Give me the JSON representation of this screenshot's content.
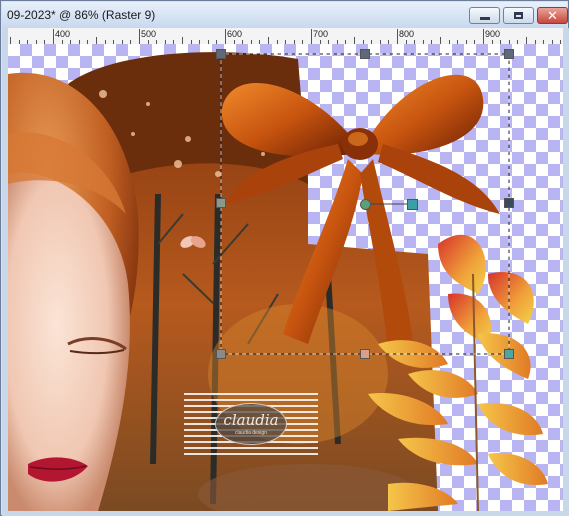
{
  "window": {
    "title": "09-2023* @  86% (Raster 9)",
    "buttons": {
      "minimize": "minimize",
      "maximize": "maximize",
      "close": "close"
    }
  },
  "ruler": {
    "labels": [
      "400",
      "500",
      "600",
      "700",
      "800",
      "900"
    ]
  },
  "watermark": {
    "name": "claudia",
    "sub": "claudia design"
  },
  "colors": {
    "checker": "#b9b5f2",
    "ribbon": "#c8550f",
    "frame": "#c9d7ea"
  },
  "icons": {
    "minimize": "minimize-icon",
    "maximize": "maximize-icon",
    "close": "close-icon",
    "rotate_handle": "rotate-handle-icon"
  }
}
